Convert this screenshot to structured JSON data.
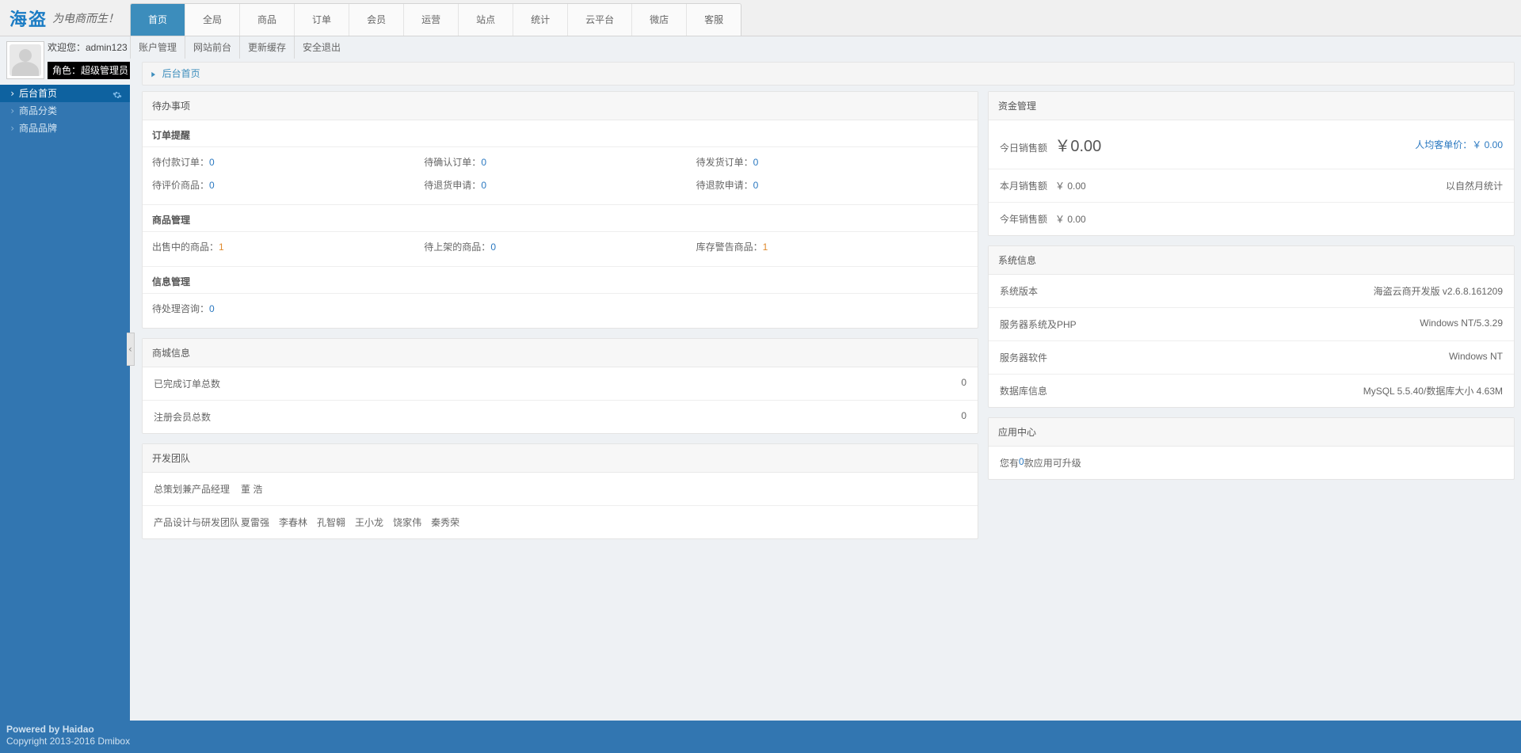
{
  "logo": {
    "main": "海盗",
    "sub": "为电商而生！"
  },
  "topnav": [
    "首页",
    "全局",
    "商品",
    "订单",
    "会员",
    "运营",
    "站点",
    "统计",
    "云平台",
    "微店",
    "客服"
  ],
  "topnav_active": 0,
  "welcome": "欢迎您：admin123",
  "actions": [
    "账户管理",
    "网站前台",
    "更新缓存",
    "安全退出"
  ],
  "role": "角色：超级管理员",
  "breadcrumb": "后台首页",
  "sidebar": [
    {
      "label": "后台首页",
      "active": true,
      "gear": true
    },
    {
      "label": "商品分类"
    },
    {
      "label": "商品品牌"
    }
  ],
  "todo": {
    "title": "待办事项",
    "order_section": "订单提醒",
    "orders": [
      {
        "label": "待付款订单：",
        "val": "0"
      },
      {
        "label": "待确认订单：",
        "val": "0"
      },
      {
        "label": "待发货订单：",
        "val": "0"
      },
      {
        "label": "待评价商品：",
        "val": "0"
      },
      {
        "label": "待退货申请：",
        "val": "0"
      },
      {
        "label": "待退款申请：",
        "val": "0"
      }
    ],
    "goods_section": "商品管理",
    "goods": [
      {
        "label": "出售中的商品：",
        "val": "1",
        "orange": true
      },
      {
        "label": "待上架的商品：",
        "val": "0"
      },
      {
        "label": "库存警告商品：",
        "val": "1",
        "orange": true
      }
    ],
    "info_section": "信息管理",
    "info": [
      {
        "label": "待处理咨询：",
        "val": "0"
      }
    ]
  },
  "mall": {
    "title": "商城信息",
    "rows": [
      {
        "label": "已完成订单总数",
        "val": "0"
      },
      {
        "label": "注册会员总数",
        "val": "0"
      }
    ]
  },
  "dev": {
    "title": "开发团队",
    "rows": [
      {
        "role": "总策划兼产品经理",
        "names": [
          "董  浩"
        ]
      },
      {
        "role": "产品设计与研发团队",
        "names": [
          "夏雷强",
          "李春林",
          "孔智翱",
          "王小龙",
          "饶家伟",
          "秦秀荣"
        ]
      }
    ]
  },
  "funds": {
    "title": "资金管理",
    "today_label": "今日销售额",
    "today_val": "￥0.00",
    "avg_label": "人均客单价：￥ 0.00",
    "rows": [
      {
        "label": "本月销售额",
        "val": "￥ 0.00",
        "note": "以自然月统计"
      },
      {
        "label": "今年销售额",
        "val": "￥ 0.00"
      }
    ]
  },
  "sysinfo": {
    "title": "系统信息",
    "rows": [
      {
        "label": "系统版本",
        "val": "海盗云商开发版 v2.6.8.161209"
      },
      {
        "label": "服务器系统及PHP",
        "val": "Windows NT/5.3.29"
      },
      {
        "label": "服务器软件",
        "val": "Windows NT"
      },
      {
        "label": "数据库信息",
        "val": "MySQL 5.5.40/数据库大小 4.63M"
      }
    ]
  },
  "appcenter": {
    "title": "应用中心",
    "pre": "您有 ",
    "count": "0",
    "post": " 款应用可升级"
  },
  "footer": {
    "p1": "Powered by Haidao",
    "p2": "Copyright 2013-2016 Dmibox"
  }
}
